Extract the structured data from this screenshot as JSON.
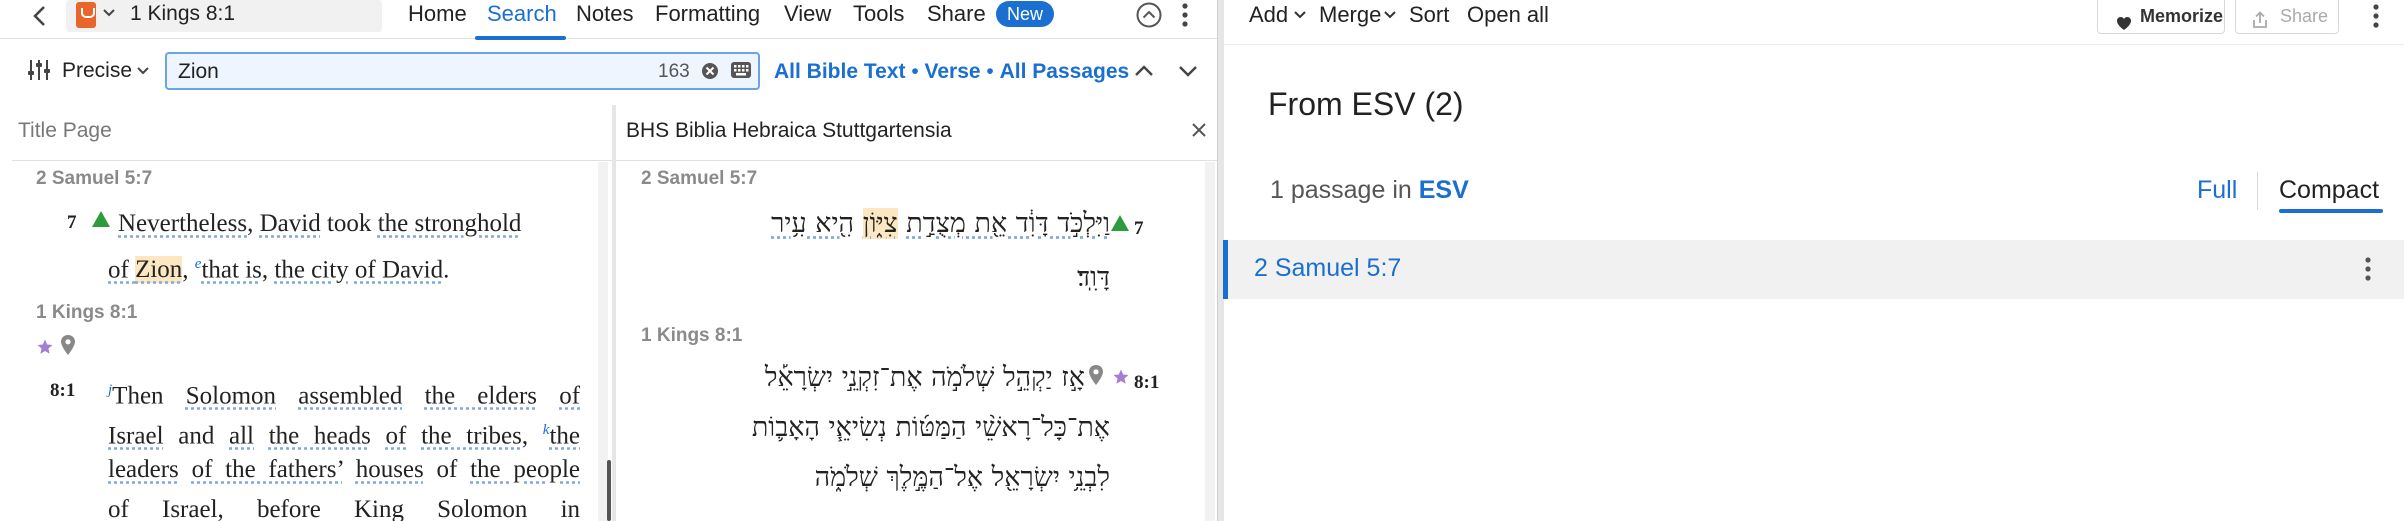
{
  "toolbar": {
    "resource_title": "1 Kings 8:1",
    "menus": [
      "Home",
      "Search",
      "Notes",
      "Formatting",
      "View",
      "Tools",
      "Share"
    ],
    "active_menu": "Search",
    "new_badge": "New"
  },
  "search": {
    "mode_label": "Precise",
    "query": "Zion",
    "result_count": "163",
    "scope_links": [
      "All Bible Text",
      "Verse",
      "All Passages"
    ],
    "separator": "•"
  },
  "panel_left": {
    "header": "Title Page",
    "sections": [
      {
        "reference": "2 Samuel 5:7",
        "verse_num": "7"
      },
      {
        "reference": "1 Kings 8:1",
        "verse_num": "8:1"
      }
    ]
  },
  "panel_right": {
    "header": "BHS Biblia Hebraica Stuttgartensia",
    "sections": [
      {
        "reference": "2 Samuel 5:7",
        "verse_num": "7"
      },
      {
        "reference": "1 Kings 8:1",
        "verse_num": "8:1"
      }
    ],
    "hebrew_2sam_line1_pre": "וַיִּלְכֹּ֣ד דָּוִ֔ד אֵ֖ת מְצֻדַ֣ת",
    "hebrew_2sam_line1_hl": "צִיּ֑וֹן",
    "hebrew_2sam_line1_post": "הִ֖יא עִ֥יר",
    "hebrew_2sam_line2": "דָּוִֽד׃",
    "hebrew_1kgs_line1": "אָ֣ז יַקְהֵ֣ל שְׁלֹמֹ֣ה אֶת־זִקְנֵ֣י יִשְׂרָאֵ֡ל",
    "hebrew_1kgs_line2": "אֶת־כָּל־רָאשֵׁ֨י הַמַּטּ֜וֹת נְשִׂיאֵ֧י הָאָב֛וֹת",
    "hebrew_1kgs_line3": "לִבְנֵ֥י יִשְׂרָאֵ֖ל אֶל־הַמֶּ֣לֶךְ שְׁלֹמֹ֑ה"
  },
  "right_pane": {
    "toolbar": [
      "Add",
      "Merge",
      "Sort",
      "Open all"
    ],
    "memorize_label": "Memorize",
    "share_label": "Share",
    "title": "From ESV (2)",
    "passage_count_prefix": "1 passage in",
    "passage_count_link": "ESV",
    "view_full": "Full",
    "view_compact": "Compact",
    "selected_view": "Compact",
    "passages": [
      "2 Samuel 5:7"
    ]
  },
  "colors": {
    "accent": "#1a6fd0",
    "highlight": "#fbe7c2",
    "triangle_green": "#2f9b3f",
    "star_purple": "#a37fd1"
  }
}
